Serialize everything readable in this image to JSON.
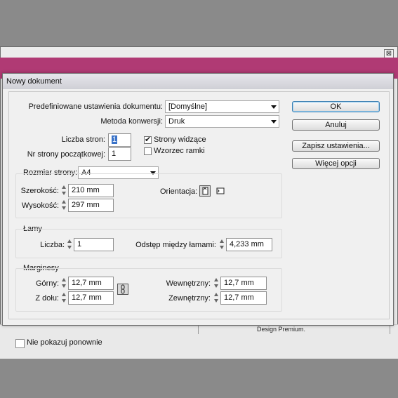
{
  "background_window": {
    "footer_text": "Design Premium.",
    "dont_show_label": "Nie pokazuj ponownie",
    "close_glyph": "⊠"
  },
  "dialog": {
    "title": "Nowy dokument",
    "preset": {
      "label": "Predefiniowane ustawienia dokumentu:",
      "value": "[Domyślne]"
    },
    "intent": {
      "label": "Metoda konwersji:",
      "value": "Druk"
    },
    "pages": {
      "label": "Liczba stron:",
      "value": "1"
    },
    "start_page": {
      "label": "Nr strony początkowej:",
      "value": "1"
    },
    "facing_pages": {
      "label": "Strony widzące",
      "checked": true
    },
    "master_frame": {
      "label": "Wzorzec ramki",
      "checked": false
    },
    "page_size": {
      "label": "Rozmiar strony:",
      "value": "A4",
      "width": {
        "label": "Szerokość:",
        "value": "210 mm"
      },
      "height": {
        "label": "Wysokość:",
        "value": "297 mm"
      },
      "orientation_label": "Orientacja:",
      "orientation": "portrait"
    },
    "columns": {
      "legend": "Łamy",
      "number": {
        "label": "Liczba:",
        "value": "1"
      },
      "gutter": {
        "label": "Odstęp między łamami:",
        "value": "4,233 mm"
      }
    },
    "margins": {
      "legend": "Marginesy",
      "top": {
        "label": "Górny:",
        "value": "12,7 mm"
      },
      "bottom": {
        "label": "Z dołu:",
        "value": "12,7 mm"
      },
      "inside": {
        "label": "Wewnętrzny:",
        "value": "12,7 mm"
      },
      "outside": {
        "label": "Zewnętrzny:",
        "value": "12,7 mm"
      }
    },
    "buttons": {
      "ok": "OK",
      "cancel": "Anuluj",
      "save_preset": "Zapisz ustawienia...",
      "more_options": "Więcej opcji"
    }
  },
  "colors": {
    "accent_band": "#b03a74",
    "ok_focus": "#3c7fb1"
  }
}
